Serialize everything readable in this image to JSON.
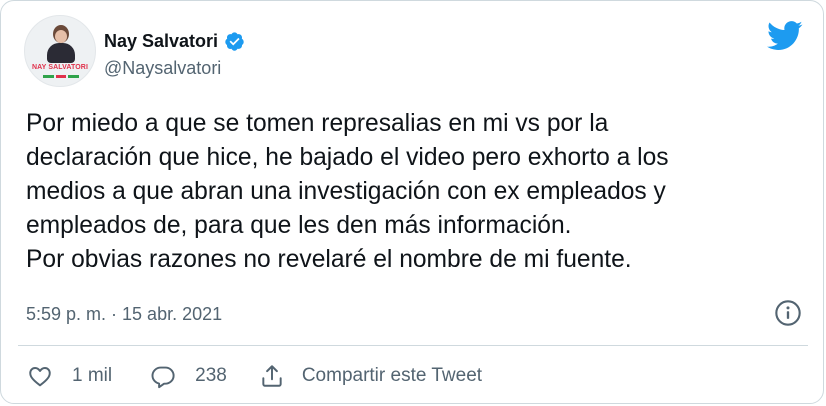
{
  "author": {
    "display_name": "Nay Salvatori",
    "handle": "@Naysalvatori",
    "avatar_text": "NAY SALVATORI",
    "verified_icon": "verified-badge-icon",
    "brand_color": "#1d9bf0"
  },
  "tweet": {
    "lines": [
      "Por miedo a que se tomen represalias en mi vs por la",
      "declaración que hice, he bajado el video pero exhorto a los",
      "medios a que abran una investigación con ex empleados y",
      "empleados de, para que les den más información.",
      "Por obvias razones no revelaré el nombre de mi fuente."
    ],
    "timestamp": "5:59 p. m. · 15 abr. 2021"
  },
  "actions": {
    "like_count": "1 mil",
    "reply_count": "238",
    "share_label": "Compartir este Tweet"
  },
  "icons": {
    "logo": "twitter-bird-icon",
    "info": "info-icon",
    "like": "heart-icon",
    "reply": "reply-bubble-icon",
    "share": "share-icon"
  },
  "colors": {
    "text": "#0f1419",
    "secondary": "#536471",
    "border": "#cfd9de"
  }
}
